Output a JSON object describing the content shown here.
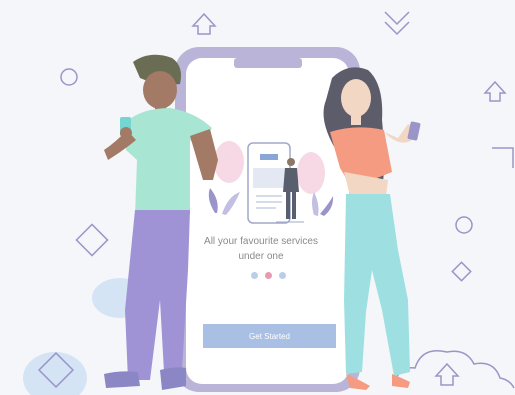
{
  "onboarding": {
    "text_line1": "All your favourite services",
    "text_line2": "under one",
    "pagination": {
      "count": 3,
      "active_index": 1
    },
    "cta_label": "Get Started"
  },
  "icons": [
    "chevron-up-outline-icon",
    "double-chevron-down-icon",
    "circle-outline-icon",
    "diamond-outline-icon",
    "corner-bracket-icon",
    "cloud-outline-icon"
  ],
  "colors": {
    "background": "#f4f6f9",
    "phone_frame": "#b9b4d8",
    "phone_screen": "#ffffff",
    "cta_button": "#a9bfe3",
    "dot_active": "#e79bb0",
    "dot_inactive": "#b9cfe8",
    "outline_shapes": "#9a95c8",
    "man_shirt": "#a8e6d3",
    "man_pants": "#9f93d6",
    "woman_top": "#f49b82",
    "woman_pants": "#9ee0e2"
  }
}
